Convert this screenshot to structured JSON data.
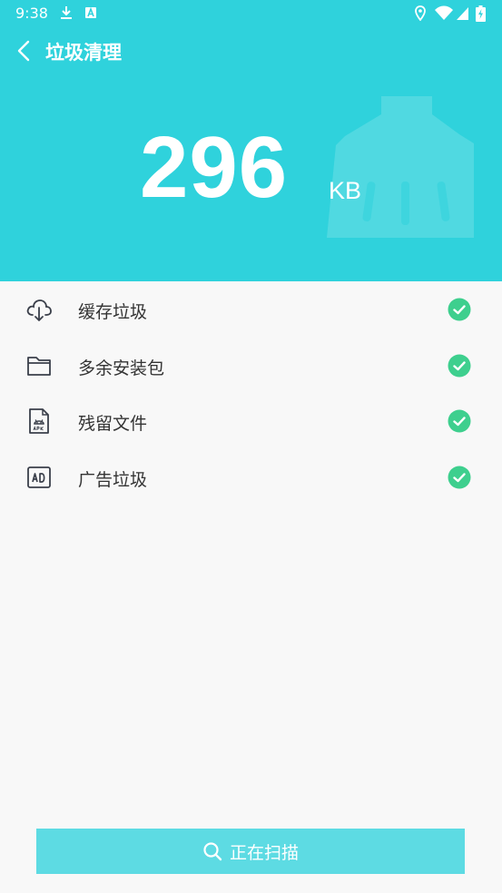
{
  "status_bar": {
    "time": "9:38"
  },
  "header": {
    "title": "垃圾清理",
    "size_value": "296",
    "size_unit": "KB",
    "background_color": "#2fd2dc"
  },
  "items": [
    {
      "label": "缓存垃圾",
      "icon": "cloud-download-icon",
      "done": true
    },
    {
      "label": "多余安装包",
      "icon": "folder-icon",
      "done": true
    },
    {
      "label": "残留文件",
      "icon": "apk-file-icon",
      "done": true
    },
    {
      "label": "广告垃圾",
      "icon": "ad-icon",
      "done": true
    }
  ],
  "scan_button": {
    "label": "正在扫描",
    "icon": "search-icon",
    "color": "#5ddbe3"
  },
  "check_color": "#3ecf8e"
}
